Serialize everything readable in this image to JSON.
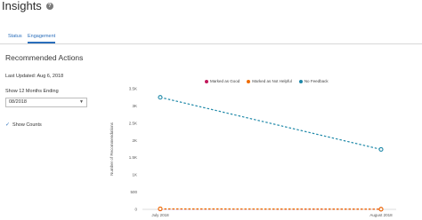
{
  "page": {
    "title": "Insights",
    "help_icon": "?"
  },
  "tabs": [
    {
      "label": "Status",
      "active": false
    },
    {
      "label": "Engagement",
      "active": true
    }
  ],
  "sidebar": {
    "section_title": "Recommended Actions",
    "last_updated": "Last Updated: Aug 6, 2018",
    "months_label": "Show 12 Months Ending",
    "month_value": "08/2018",
    "show_counts_label": "Show Counts",
    "show_counts_checked": true
  },
  "colors": {
    "accent": "#2a6ebb",
    "good": "#c2185b",
    "not_helpful": "#ef6c00",
    "no_feedback": "#1e88a8"
  },
  "chart_data": {
    "type": "line",
    "ylabel": "Number of Recommendations",
    "ylim": [
      0,
      3500
    ],
    "yticks": [
      0,
      500,
      1000,
      1500,
      2000,
      2500,
      3000,
      3500
    ],
    "ytick_labels": [
      "0",
      "500",
      "1K",
      "1.5K",
      "2K",
      "2.5K",
      "3K",
      "3.5K"
    ],
    "categories": [
      "July 2018",
      "August 2018"
    ],
    "legend_position": "top",
    "series": [
      {
        "name": "Marked as Good",
        "values": [
          10,
          5
        ],
        "color": "#c2185b"
      },
      {
        "name": "Marked as Not Helpful",
        "values": [
          15,
          5
        ],
        "color": "#ef6c00"
      },
      {
        "name": "No Feedback",
        "values": [
          3250,
          1740
        ],
        "color": "#1e88a8"
      }
    ]
  }
}
